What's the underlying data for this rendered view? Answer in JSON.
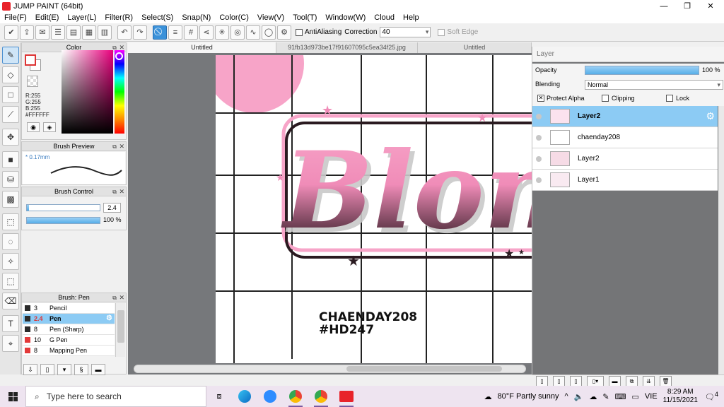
{
  "window": {
    "title": "JUMP PAINT (64bit)",
    "controls": [
      "—",
      "❐",
      "✕"
    ]
  },
  "menu": [
    "File(F)",
    "Edit(E)",
    "Layer(L)",
    "Filter(R)",
    "Select(S)",
    "Snap(N)",
    "Color(C)",
    "View(V)",
    "Tool(T)",
    "Window(W)",
    "Cloud",
    "Help"
  ],
  "toolbar": {
    "antialiasing_label": "AntiAliasing",
    "correction_label": "Correction",
    "correction_value": "40",
    "soft_edge_label": "Soft Edge"
  },
  "color_panel": {
    "title": "Color",
    "r": "R:255",
    "g": "G:255",
    "b": "B:255",
    "hex": "#FFFFFF"
  },
  "brush_preview": {
    "title": "Brush Preview",
    "size": "* 0.17mm"
  },
  "brush_control": {
    "title": "Brush Control",
    "size_value": "2.4",
    "size_fraction": 0.03,
    "opacity_value": "100 %",
    "opacity_fraction": 1.0
  },
  "brush_panel": {
    "title": "Brush: Pen",
    "items": [
      {
        "size": "3",
        "name": "Pencil",
        "color": "#2b2b2b"
      },
      {
        "size": "2.4",
        "name": "Pen",
        "color": "#2b2b2b"
      },
      {
        "size": "8",
        "name": "Pen (Sharp)",
        "color": "#2b2b2b"
      },
      {
        "size": "10",
        "name": "G Pen",
        "color": "#e33a3a"
      },
      {
        "size": "8",
        "name": "Mapping Pen",
        "color": "#e33a3a"
      }
    ]
  },
  "tabs": [
    "Untitled",
    "91fb13d973be17f91607095c5ea34f25.jpg",
    "Untitled"
  ],
  "canvas": {
    "caption_line1": "CHAENDAY208",
    "caption_line2": "#HD247",
    "art_text": "Blon"
  },
  "layer_panel": {
    "title": "Layer",
    "opacity_label": "Opacity",
    "opacity_value": "100 %",
    "blending_label": "Blending",
    "blending_value": "Normal",
    "protect_alpha": "Protect Alpha",
    "clipping": "Clipping",
    "lock": "Lock",
    "layers": [
      "Layer2",
      "chaenday208",
      "Layer2",
      "Layer1"
    ]
  },
  "taskbar": {
    "search_placeholder": "Type here to search",
    "weather": "80°F  Partly sunny",
    "lang": "VIE",
    "time": "8:29 AM",
    "date": "11/15/2021",
    "notifications": "4"
  },
  "colors": {
    "accent": "#3a91d9",
    "selection": "#8ccbf4",
    "pink": "#f7a4c8"
  }
}
